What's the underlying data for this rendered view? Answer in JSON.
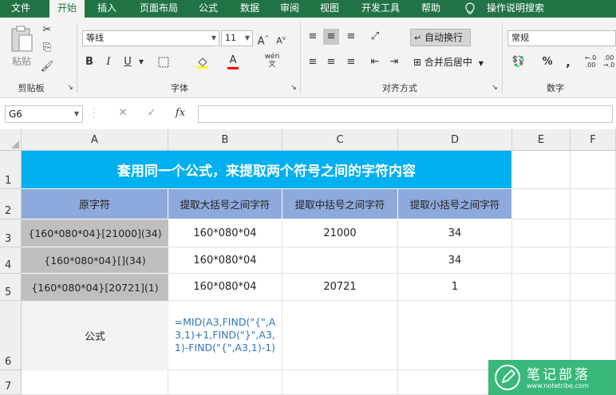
{
  "tabs": [
    "文件",
    "开始",
    "插入",
    "页面布局",
    "公式",
    "数据",
    "审阅",
    "视图",
    "开发工具",
    "帮助",
    "操作说明搜索"
  ],
  "ribbon": {
    "clipboard": {
      "paste": "粘贴",
      "label": "剪贴板"
    },
    "font": {
      "name": "等线",
      "size": "11",
      "label": "字体",
      "bold": "B",
      "italic": "I",
      "underline": "U",
      "grow": "A",
      "shrink": "A",
      "color": "A",
      "wen": "wén"
    },
    "align": {
      "wrap": "自动换行",
      "merge": "合并后居中",
      "label": "对齐方式"
    },
    "number": {
      "format": "常规",
      "label": "数字",
      "percent": "%",
      "comma": "9",
      "dec1": "←.0 .00",
      "dec2": ".00 →.0"
    }
  },
  "formula_bar": {
    "name_box": "G6",
    "fx": "fx"
  },
  "columns": [
    "A",
    "B",
    "C",
    "D",
    "E",
    "F"
  ],
  "rows": [
    "1",
    "2",
    "3",
    "4",
    "5",
    "6",
    "7"
  ],
  "sheet": {
    "title": "套用同一个公式，来提取两个符号之间的字符内容",
    "headers": [
      "原字符",
      "提取大括号之间字符",
      "提取中括号之间字符",
      "提取小括号之间字符"
    ],
    "data": [
      [
        "{160*080*04}[21000](34)",
        "160*080*04",
        "21000",
        "34"
      ],
      [
        "{160*080*04}[](34)",
        "160*080*04",
        "",
        "34"
      ],
      [
        "{160*080*04}[20721](1)",
        "160*080*04",
        "20721",
        "1"
      ]
    ],
    "formula_label": "公式",
    "formula_text": "=MID(A3,FIND(\"{\",A3,1)+1,FIND(\"}\",A3,1)-FIND(\"{\",A3,1)-1)"
  },
  "watermark": {
    "name": "笔记部落",
    "url": "www.notetribe.com"
  },
  "colors": {
    "excel_green": "#217346",
    "title_bg": "#00b0f0",
    "header_bg": "#8ea9db",
    "a_col_bg": "#bfbfbf",
    "formula_color": "#2e75b6",
    "watermark_bg": "#2fb574"
  }
}
